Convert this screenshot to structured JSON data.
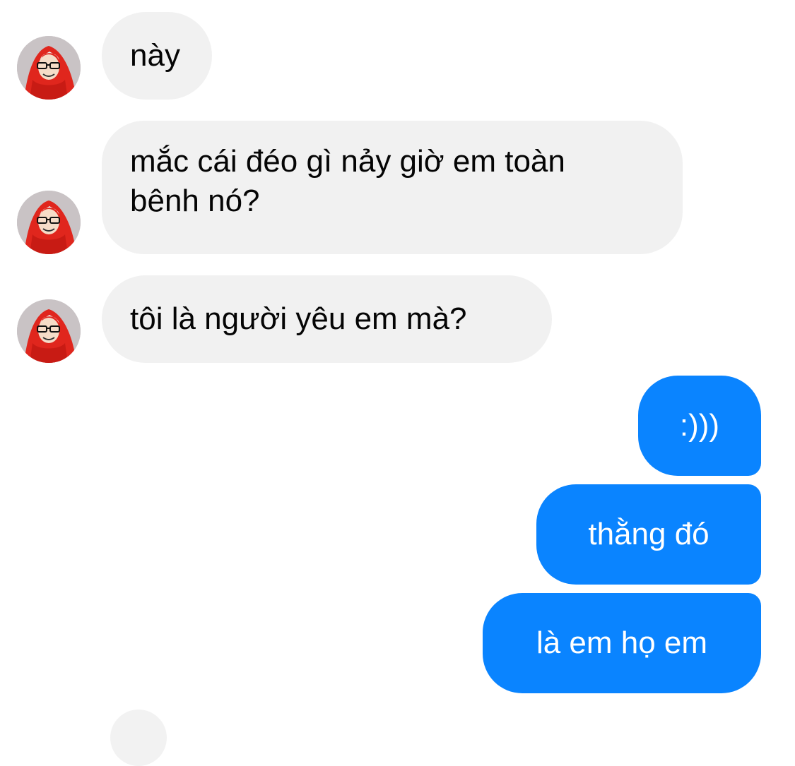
{
  "conversation": {
    "incoming": [
      {
        "text": "này"
      },
      {
        "text": "mắc cái đéo gì nảy giờ em toàn\nbênh nó?"
      },
      {
        "text": "tôi là người yêu em mà?"
      }
    ],
    "outgoing": [
      {
        "text": ":)))"
      },
      {
        "text": "thằng đó"
      },
      {
        "text": "là em họ em"
      }
    ]
  },
  "colors": {
    "incoming_bubble": "#f1f1f1",
    "outgoing_bubble": "#0a84ff",
    "avatar_accent": "#e0261d"
  },
  "icons": {
    "avatar": "contact-avatar-icon"
  }
}
